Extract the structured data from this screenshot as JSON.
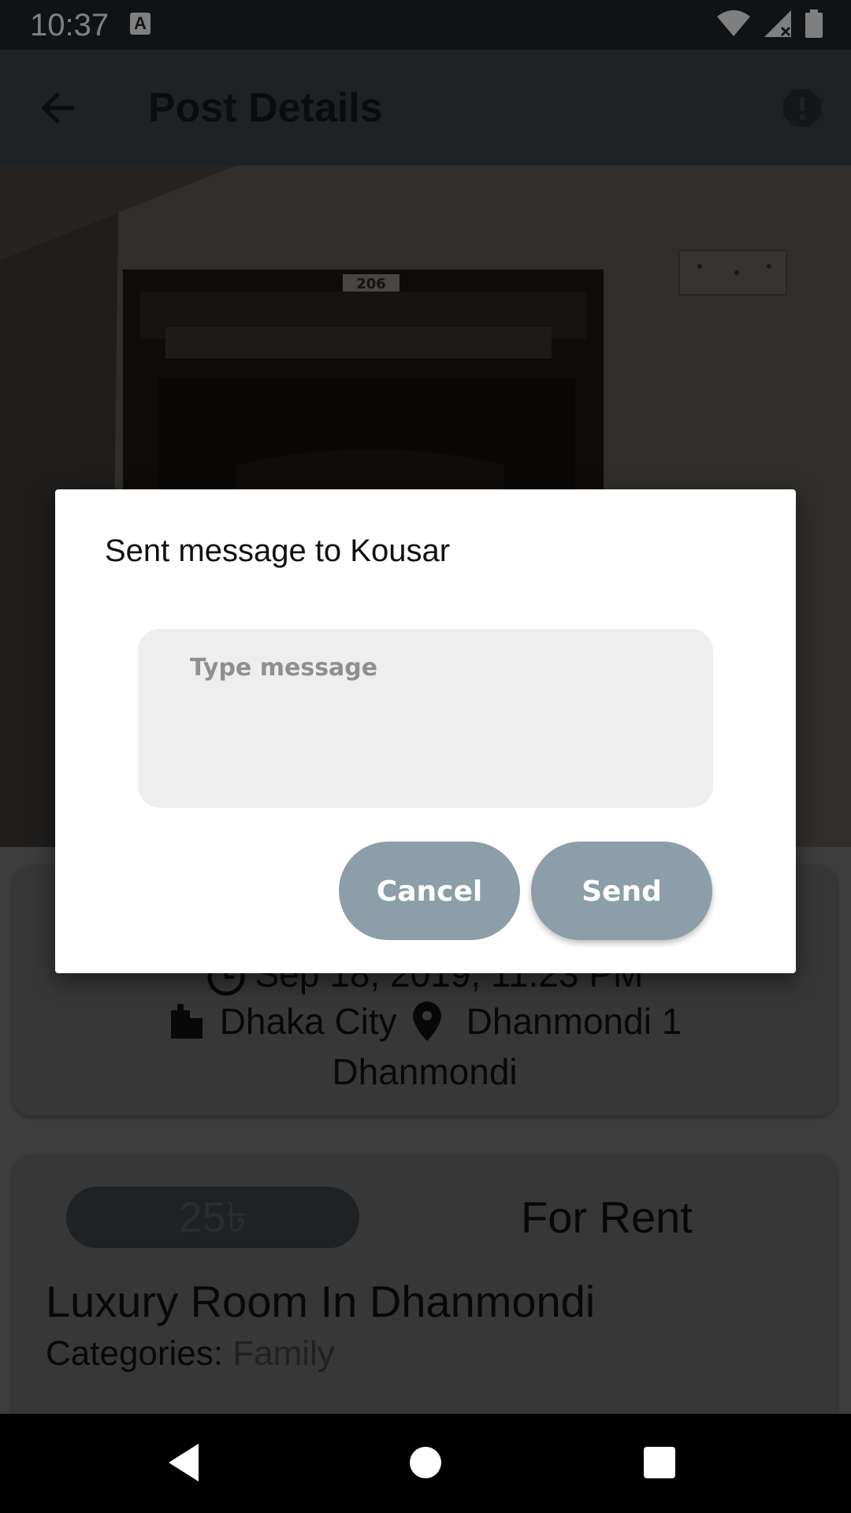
{
  "status_bar": {
    "time": "10:37",
    "keyboard_icon_letter": "A"
  },
  "app_bar": {
    "title": "Post Details"
  },
  "photo": {
    "door_number": "206"
  },
  "info_card": {
    "date": "Sep 18, 2019, 11:23 PM",
    "city": "Dhaka City",
    "address": "Dhanmondi 1",
    "area": "Dhanmondi"
  },
  "detail_card": {
    "price": "25৳",
    "rent_type": "For Rent",
    "title": "Luxury Room In Dhanmondi",
    "categories_label": "Categories:",
    "categories_value": "Family"
  },
  "dialog": {
    "title": "Sent message to Kousar",
    "input_placeholder": "Type message",
    "input_value": "",
    "cancel_label": "Cancel",
    "send_label": "Send"
  },
  "colors": {
    "app_bar": "#3c4449",
    "status_bar": "#20262a",
    "button": "#8c9ea7",
    "input_bg": "#eeeeee"
  }
}
